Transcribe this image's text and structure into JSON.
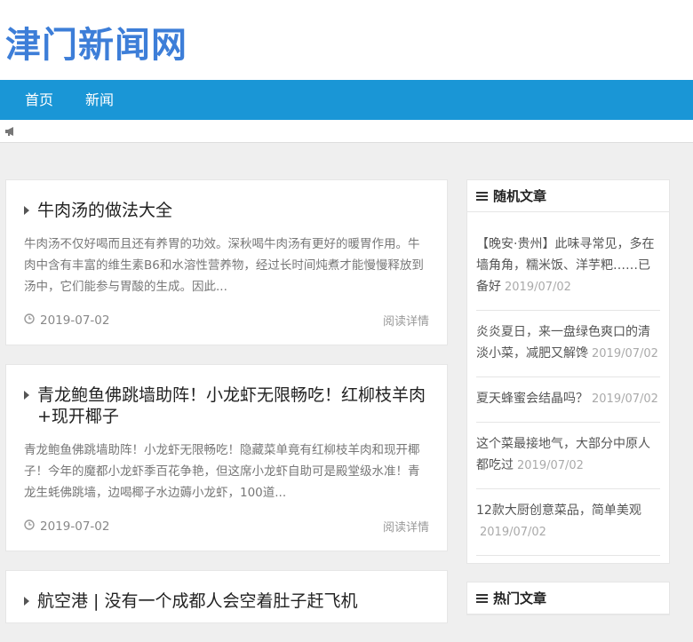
{
  "site": {
    "name": "津门新闻网"
  },
  "nav": {
    "items": [
      "首页",
      "新闻"
    ]
  },
  "notice": {
    "icon": "megaphone-icon",
    "text": ""
  },
  "articles": [
    {
      "title": "牛肉汤的做法大全",
      "excerpt": "牛肉汤不仅好喝而且还有养胃的功效。深秋喝牛肉汤有更好的暖胃作用。牛肉中含有丰富的维生素B6和水溶性营养物，经过长时间炖煮才能慢慢释放到汤中，它们能参与胃酸的生成。因此...",
      "date": "2019-07-02",
      "more": "阅读详情"
    },
    {
      "title": "青龙鲍鱼佛跳墙助阵！小龙虾无限畅吃！红柳枝羊肉+现开椰子",
      "excerpt": "青龙鲍鱼佛跳墙助阵！小龙虾无限畅吃！隐藏菜单竟有红柳枝羊肉和现开椰子！今年的魔都小龙虾季百花争艳，但这席小龙虾自助可是殿堂级水准！青龙生蚝佛跳墙，边喝椰子水边薅小龙虾，100道...",
      "date": "2019-07-02",
      "more": "阅读详情"
    },
    {
      "title": "航空港 | 没有一个成都人会空着肚子赶飞机",
      "excerpt": "",
      "date": "",
      "more": ""
    }
  ],
  "sidebar": {
    "random": {
      "title": "随机文章",
      "items": [
        {
          "text": "【晚安·贵州】此味寻常见，多在墙角角，糯米饭、洋芋粑……已备好",
          "date": "2019/07/02"
        },
        {
          "text": "炎炎夏日，来一盘绿色爽口的清淡小菜，减肥又解馋",
          "date": "2019/07/02"
        },
        {
          "text": "夏天蜂蜜会结晶吗？",
          "date": "2019/07/02"
        },
        {
          "text": "这个菜最接地气，大部分中原人都吃过",
          "date": "2019/07/02"
        },
        {
          "text": "12款大厨创意菜品，简单美观",
          "date": "2019/07/02"
        }
      ]
    },
    "hot": {
      "title": "热门文章"
    }
  }
}
